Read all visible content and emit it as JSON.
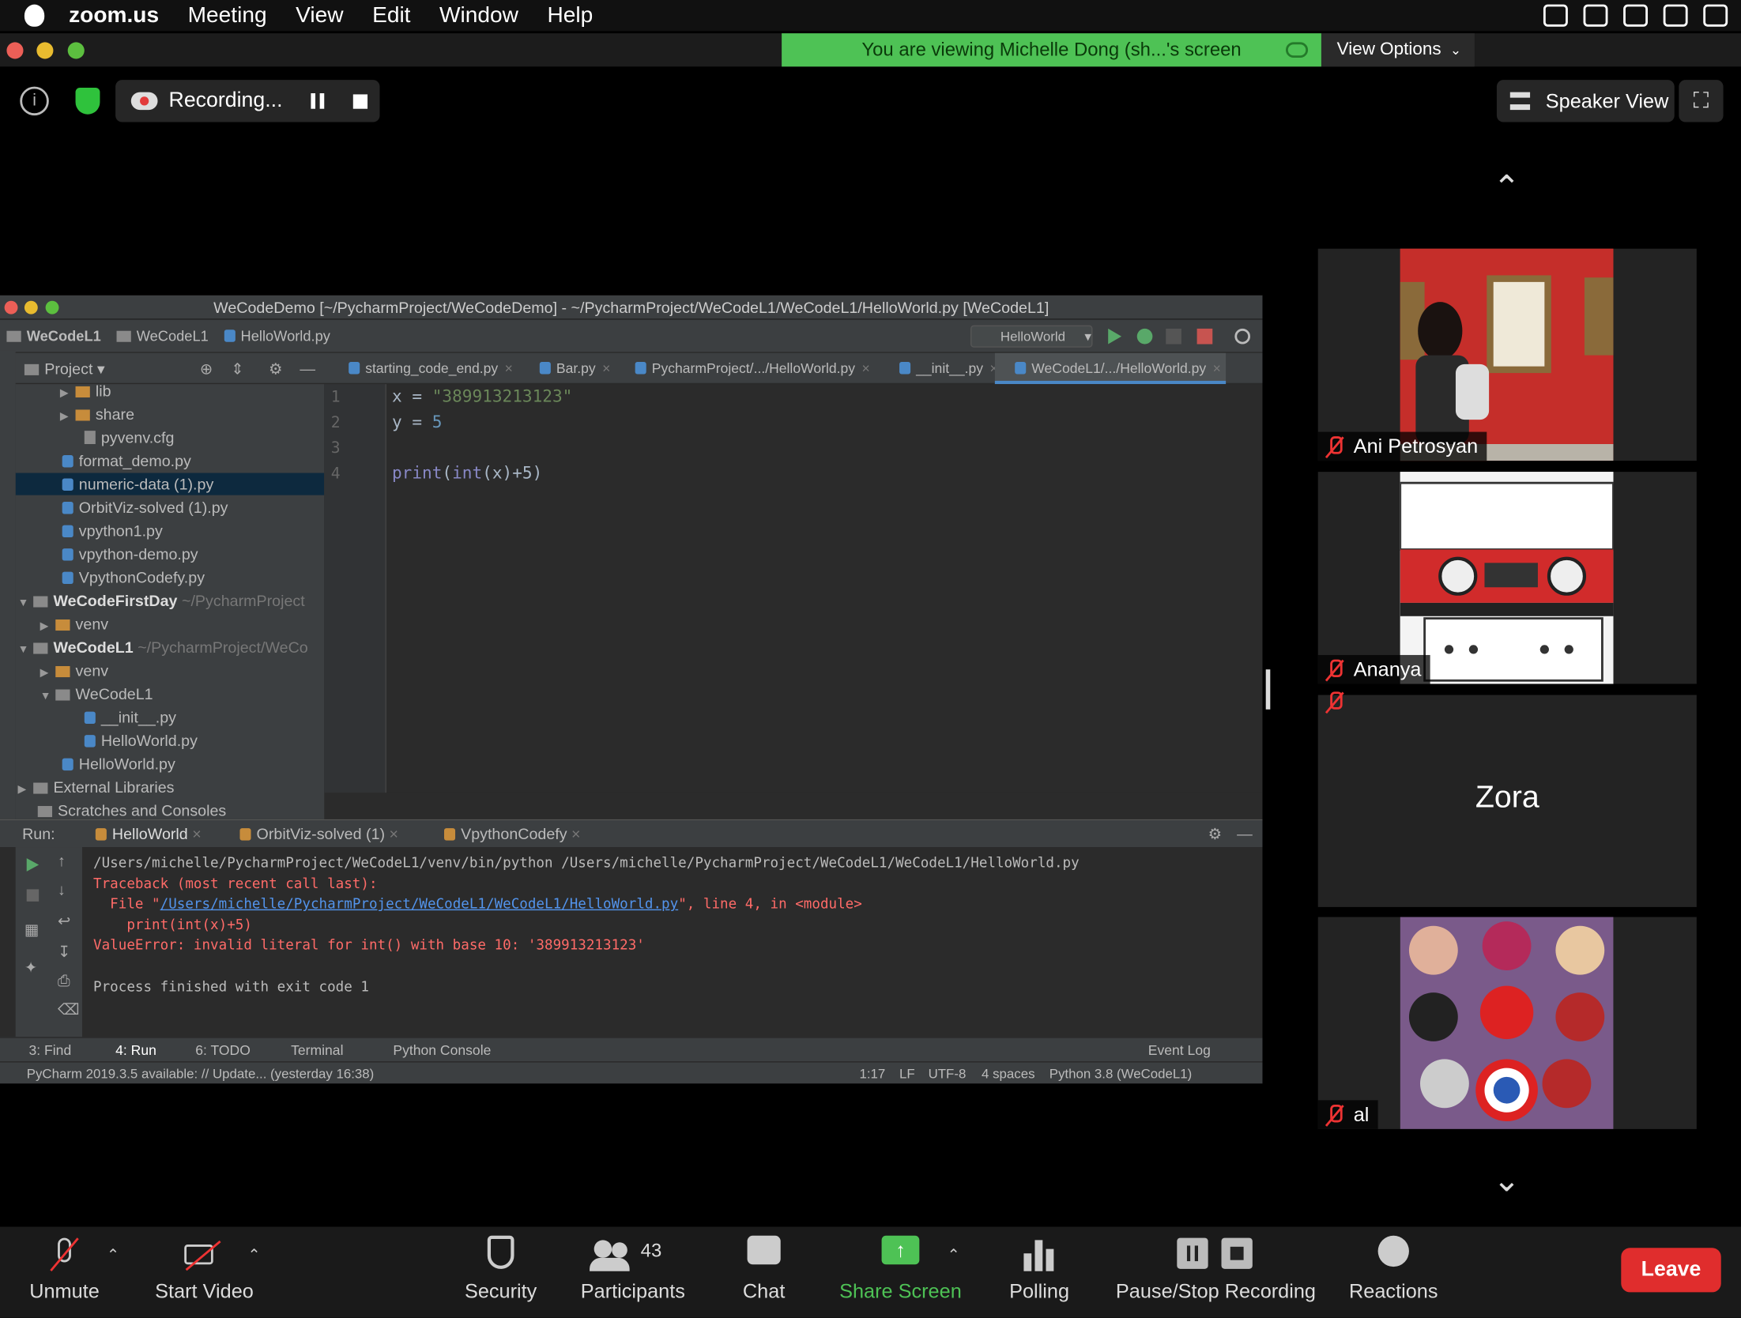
{
  "menubar": {
    "app": "zoom.us",
    "items": [
      "Meeting",
      "View",
      "Edit",
      "Window",
      "Help"
    ]
  },
  "banner": {
    "text": "You are viewing Michelle Dong (sh...'s screen",
    "view_options": "View Options"
  },
  "recording": {
    "label": "Recording..."
  },
  "speaker_view": {
    "label": "Speaker View"
  },
  "participants": [
    {
      "name": "Ani Petrosyan",
      "muted": true
    },
    {
      "name": "Ananya",
      "muted": true
    },
    {
      "name": "Zora",
      "muted": true
    },
    {
      "name": "al",
      "muted": true
    }
  ],
  "pycharm": {
    "title": "WeCodeDemo [~/PycharmProject/WeCodeDemo] - ~/PycharmProject/WeCodeL1/WeCodeL1/HelloWorld.py [WeCodeL1]",
    "breadcrumb": [
      "WeCodeL1",
      "WeCodeL1",
      "HelloWorld.py"
    ],
    "run_config": "HelloWorld",
    "project_label": "Project",
    "tabs": [
      "starting_code_end.py",
      "Bar.py",
      "PycharmProject/.../HelloWorld.py",
      "__init__.py",
      "WeCodeL1/.../HelloWorld.py"
    ],
    "tree": [
      {
        "label": "lib",
        "type": "dir"
      },
      {
        "label": "share",
        "type": "dir"
      },
      {
        "label": "pyvenv.cfg",
        "type": "file"
      },
      {
        "label": "format_demo.py",
        "type": "file"
      },
      {
        "label": "numeric-data (1).py",
        "type": "file",
        "selected": true
      },
      {
        "label": "OrbitViz-solved (1).py",
        "type": "file"
      },
      {
        "label": "vpython1.py",
        "type": "file"
      },
      {
        "label": "vpython-demo.py",
        "type": "file"
      },
      {
        "label": "VpythonCodefy.py",
        "type": "file"
      },
      {
        "label": "WeCodeFirstDay",
        "extra": "~/PycharmProject",
        "type": "project"
      },
      {
        "label": "venv",
        "type": "dir"
      },
      {
        "label": "WeCodeL1",
        "extra": "~/PycharmProject/WeCo",
        "type": "project"
      },
      {
        "label": "venv",
        "type": "dir"
      },
      {
        "label": "WeCodeL1",
        "type": "dir"
      },
      {
        "label": "__init__.py",
        "type": "file"
      },
      {
        "label": "HelloWorld.py",
        "type": "file"
      },
      {
        "label": "HelloWorld.py",
        "type": "file"
      },
      {
        "label": "External Libraries",
        "type": "lib"
      },
      {
        "label": "Scratches and Consoles",
        "type": "lib"
      }
    ],
    "code": {
      "line1_a": "x = ",
      "line1_str": "\"389913213123\"",
      "line2_a": "y = ",
      "line2_num": "5",
      "line4_fn1": "print",
      "line4_fn2": "int",
      "line4_rest": "(x)+5)"
    },
    "line_numbers": [
      "1",
      "2",
      "3",
      "4"
    ],
    "run": {
      "label": "Run:",
      "tabs": [
        "HelloWorld",
        "OrbitViz-solved (1)",
        "VpythonCodefy"
      ],
      "lines": {
        "cmd": "/Users/michelle/PycharmProject/WeCodeL1/venv/bin/python /Users/michelle/PycharmProject/WeCodeL1/WeCodeL1/HelloWorld.py",
        "tb": "Traceback (most recent call last):",
        "file_pre": "  File \"",
        "file_link": "/Users/michelle/PycharmProject/WeCodeL1/WeCodeL1/HelloWorld.py",
        "file_post": "\", line 4, in <module>",
        "stmt": "    print(int(x)+5)",
        "err": "ValueError: invalid literal for int() with base 10: '389913213123'",
        "exit": "Process finished with exit code 1"
      }
    },
    "bottom_tabs": [
      "3: Find",
      "4: Run",
      "6: TODO",
      "Terminal",
      "Python Console"
    ],
    "event_log": "Event Log",
    "status": {
      "left": "PyCharm 2019.3.5 available: // Update... (yesterday 16:38)",
      "pos": "1:17",
      "lf": "LF",
      "enc": "UTF-8",
      "indent": "4 spaces",
      "interp": "Python 3.8 (WeCodeL1)"
    }
  },
  "toolbar": {
    "unmute": "Unmute",
    "start_video": "Start Video",
    "security": "Security",
    "participants": "Participants",
    "participants_count": "43",
    "chat": "Chat",
    "share_screen": "Share Screen",
    "polling": "Polling",
    "pause_stop": "Pause/Stop Recording",
    "reactions": "Reactions",
    "leave": "Leave"
  },
  "colors": {
    "accent_green": "#4ec255",
    "leave_red": "#e02d2d",
    "pycharm_bg": "#2b2b2b"
  }
}
